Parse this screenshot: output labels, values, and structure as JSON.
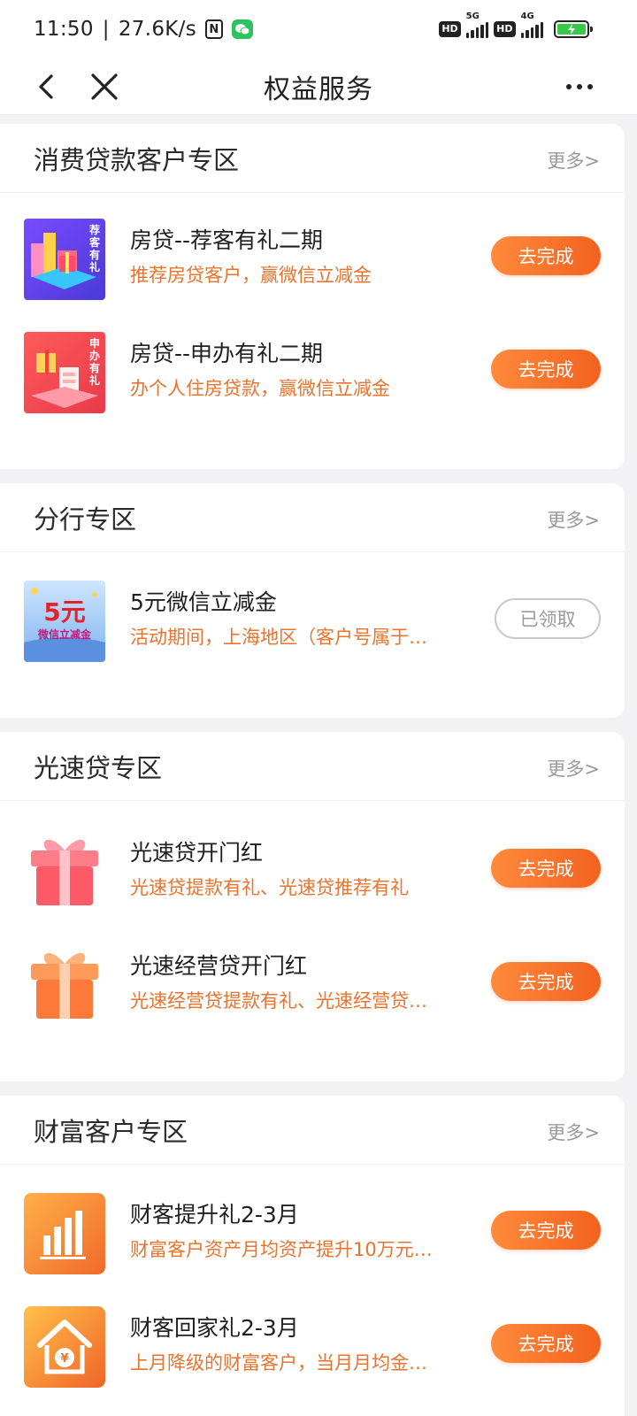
{
  "status_bar": {
    "time": "11:50",
    "speed": "27.6K/s",
    "nfc": "N",
    "hd1": "HD",
    "net1": "5G",
    "hd2": "HD",
    "net2": "4G"
  },
  "nav": {
    "title": "权益服务"
  },
  "sections": [
    {
      "title": "消费贷款客户专区",
      "more": "更多>",
      "items": [
        {
          "title": "房贷--荐客有礼二期",
          "desc": "推荐房贷客户，赢微信立减金",
          "button": "去完成",
          "thumb_text": "荐客有礼"
        },
        {
          "title": "房贷--申办有礼二期",
          "desc": "办个人住房贷款，赢微信立减金",
          "button": "去完成",
          "thumb_text": "申办有礼"
        }
      ]
    },
    {
      "title": "分行专区",
      "more": "更多>",
      "items": [
        {
          "title": "5元微信立减金",
          "desc": "活动期间，上海地区（客户号属于…",
          "button": "已领取",
          "thumb_big": "5元",
          "thumb_small": "微信立减金"
        }
      ]
    },
    {
      "title": "光速贷专区",
      "more": "更多>",
      "items": [
        {
          "title": "光速贷开门红",
          "desc": "光速贷提款有礼、光速贷推荐有礼",
          "button": "去完成"
        },
        {
          "title": "光速经营贷开门红",
          "desc": "光速经营贷提款有礼、光速经营贷…",
          "button": "去完成"
        }
      ]
    },
    {
      "title": "财富客户专区",
      "more": "更多>",
      "items": [
        {
          "title": "财客提升礼2-3月",
          "desc": "财富客户资产月均资产提升10万元…",
          "button": "去完成"
        },
        {
          "title": "财客回家礼2-3月",
          "desc": "上月降级的财富客户，当月月均金…",
          "button": "去完成"
        }
      ]
    }
  ],
  "colors": {
    "accent_orange": "#f2621f",
    "desc_orange": "#e8742f",
    "done_gray": "#9a9a9a"
  }
}
